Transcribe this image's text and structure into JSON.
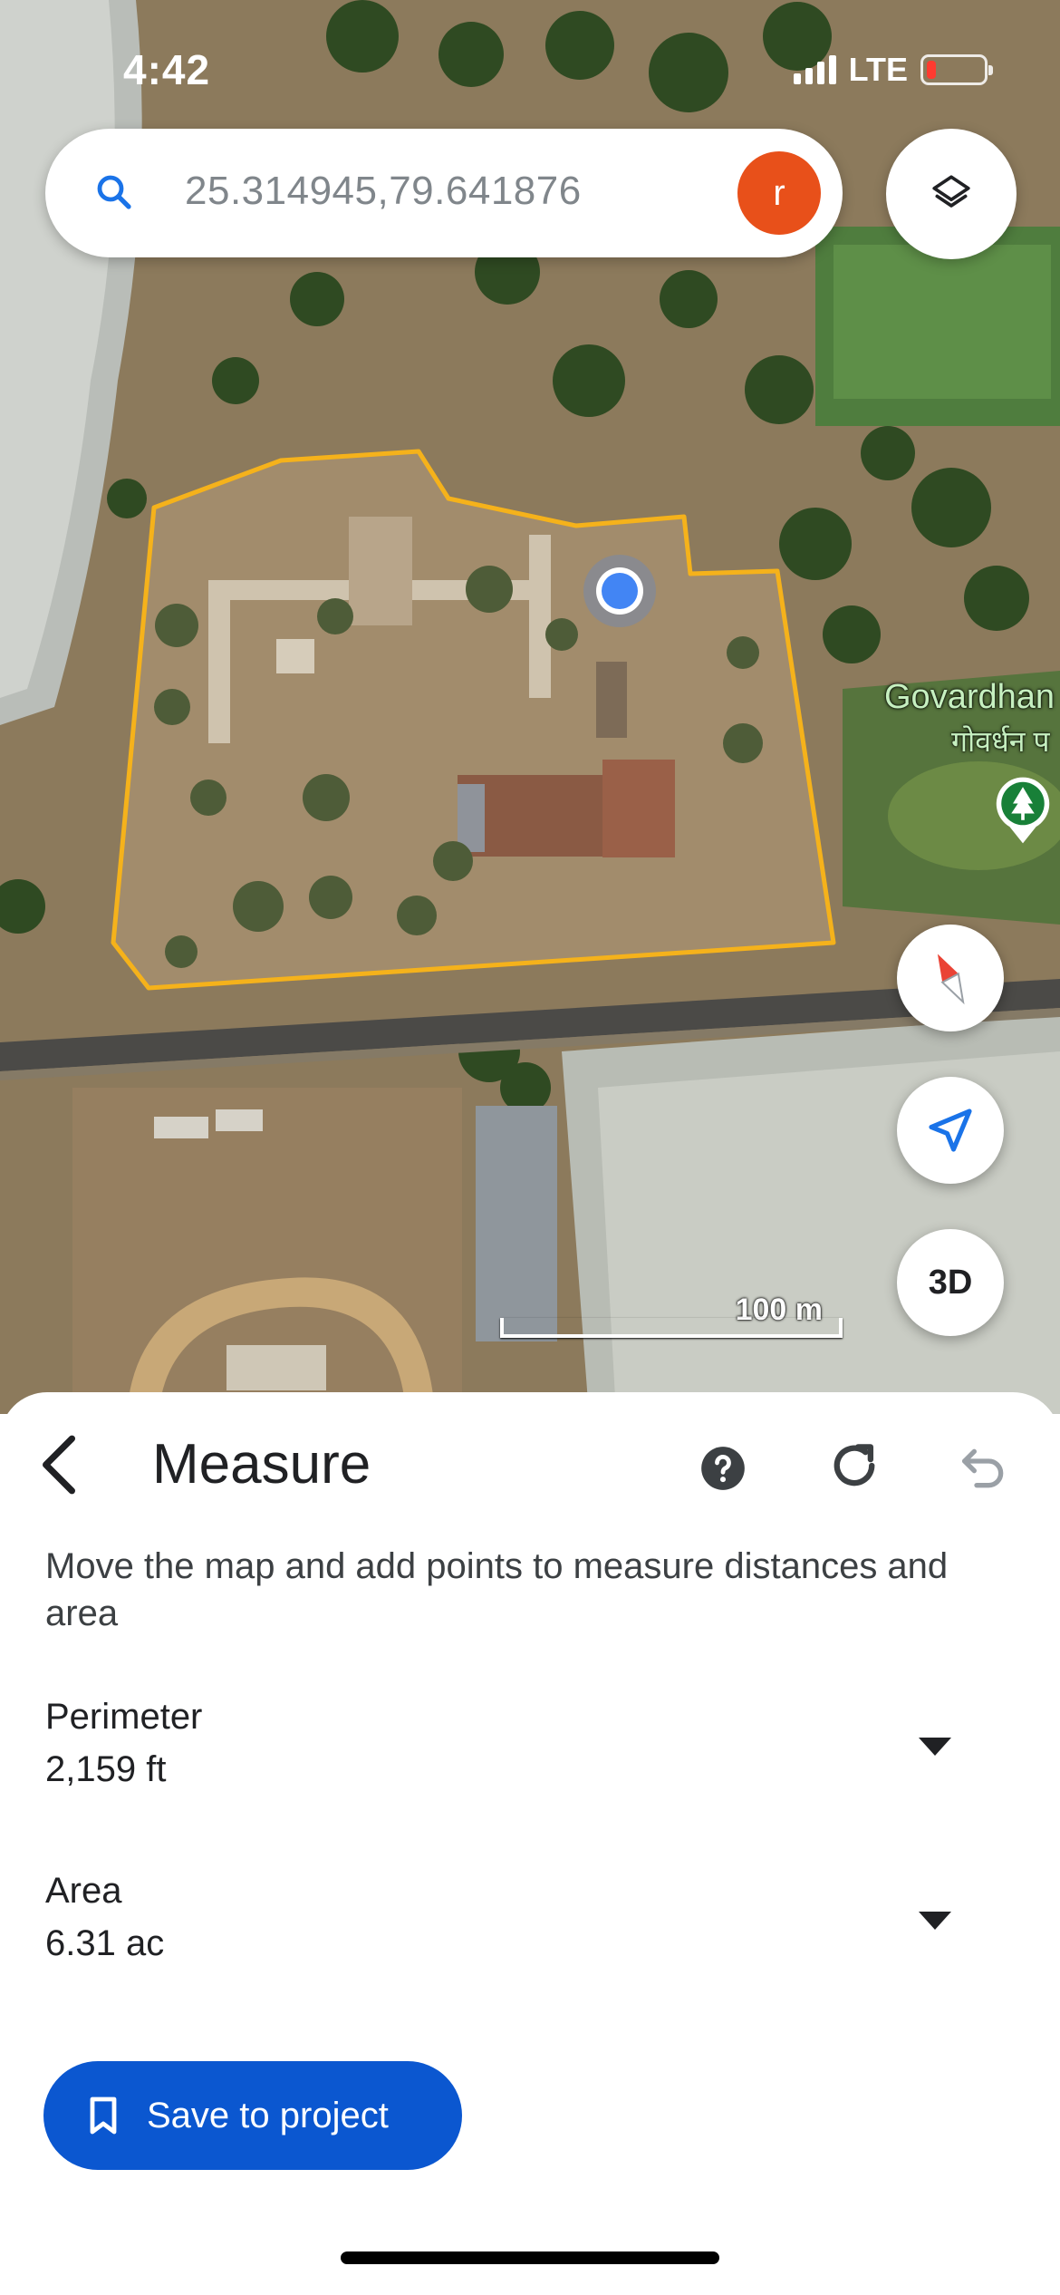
{
  "status_bar": {
    "time": "4:42",
    "network": "LTE"
  },
  "search": {
    "query": "25.314945,79.641876",
    "avatar_initial": "r"
  },
  "map": {
    "place_name": "Govardhan",
    "place_name_local": "गोवर्धन प",
    "scale_label": "100 m",
    "three_d_label": "3D",
    "polygon_color": "#f5b21b",
    "location_dot_color": "#4285f4"
  },
  "icons": [
    "search-icon",
    "layers-icon",
    "compass-icon",
    "locate-icon",
    "park-icon",
    "back-icon",
    "help-icon",
    "refresh-icon",
    "undo-icon",
    "bookmark-icon",
    "chevron-down-icon"
  ],
  "measure": {
    "title": "Measure",
    "instructions": "Move the map and add points to measure distances and area",
    "perimeter": {
      "label": "Perimeter",
      "value": "2,159 ft"
    },
    "area": {
      "label": "Area",
      "value": "6.31 ac"
    },
    "save_label": "Save to project"
  },
  "colors": {
    "accent": "#0b57d0",
    "avatar": "#e8501a",
    "battery_low": "#ff3b30"
  }
}
